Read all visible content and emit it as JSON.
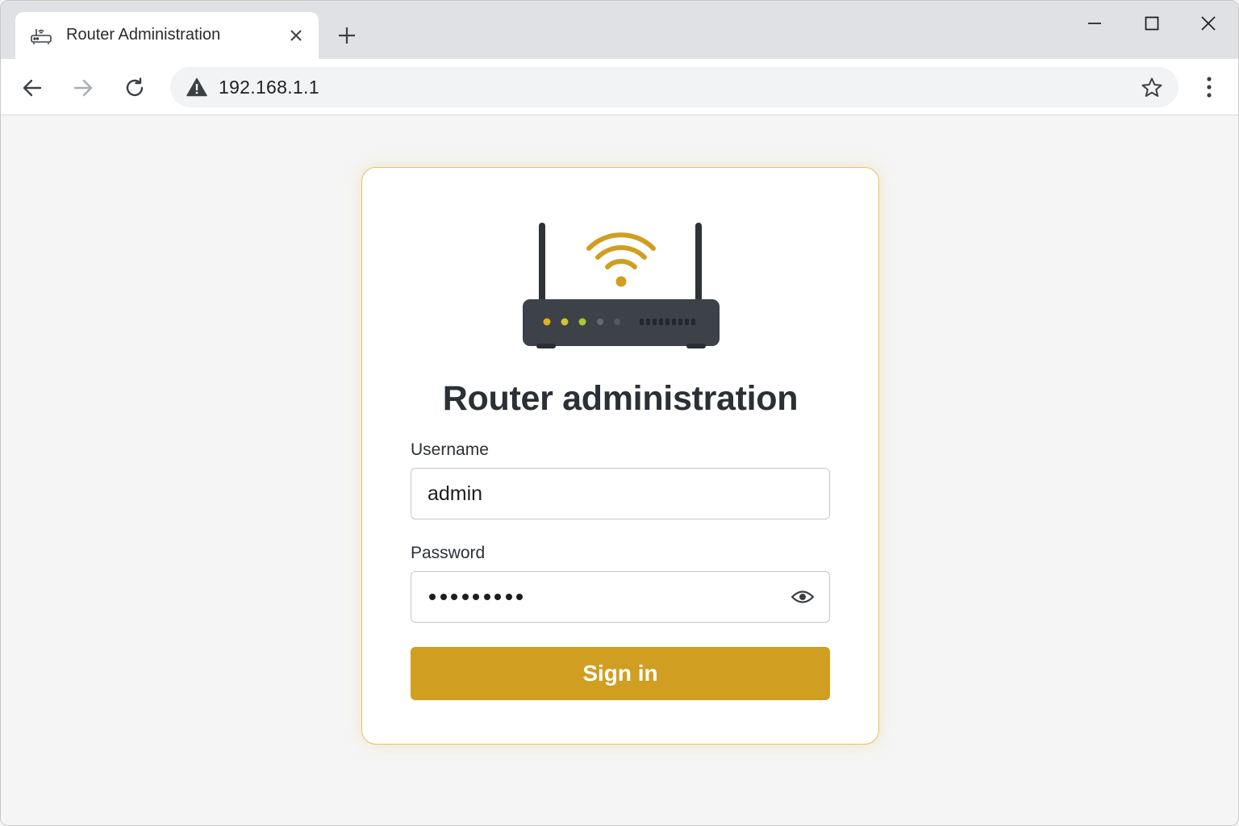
{
  "browser": {
    "tab": {
      "title": "Router Administration",
      "favicon": "router-icon"
    },
    "new_tab_icon": "plus-icon",
    "window_controls": [
      "minimize-icon",
      "maximize-icon",
      "close-icon"
    ],
    "toolbar": {
      "back_icon": "arrow-left-icon",
      "forward_icon": "arrow-right-icon",
      "reload_icon": "reload-icon",
      "security_icon": "warning-icon",
      "url": "192.168.1.1",
      "bookmark_icon": "star-icon",
      "menu_icon": "kebab-menu-icon"
    }
  },
  "login": {
    "illustration": "wifi-router-icon",
    "title": "Router administration",
    "username_label": "Username",
    "username_value": "admin",
    "password_label": "Password",
    "password_masked_length": 9,
    "show_password_icon": "eye-icon",
    "submit_label": "Sign in"
  },
  "colors": {
    "accent": "#d09e20",
    "card_border": "#e8c05a",
    "text_dark": "#2b3036",
    "led_yellow": "#e0b01c",
    "led_green": "#a8c93a"
  }
}
